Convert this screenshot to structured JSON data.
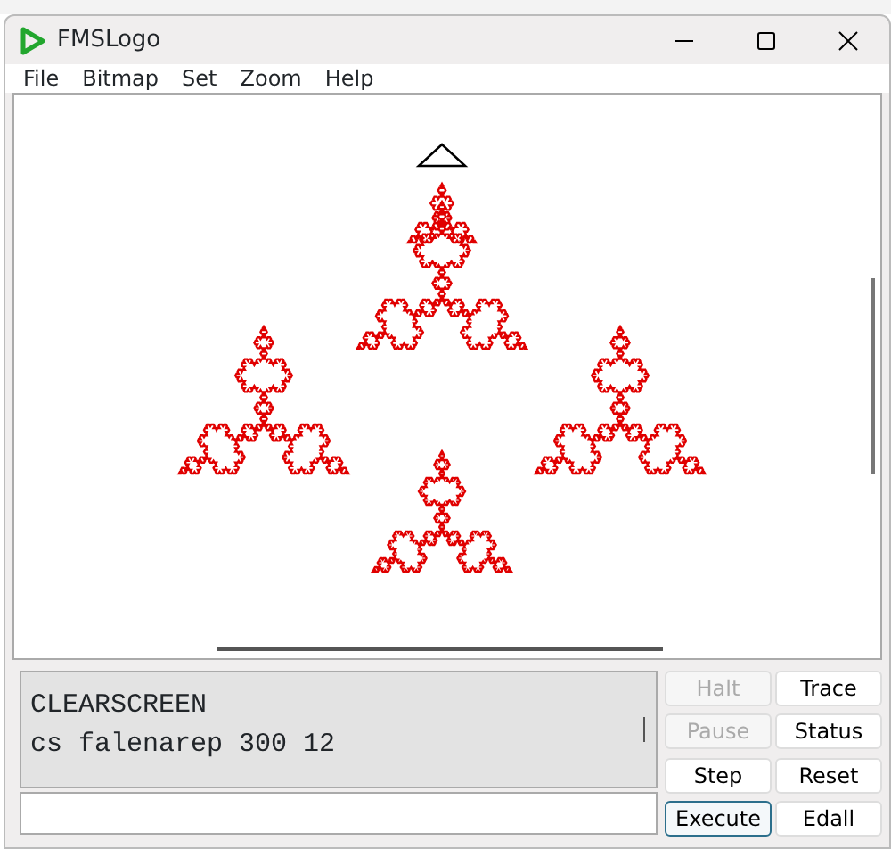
{
  "window": {
    "title": "FMSLogo"
  },
  "menu": [
    "File",
    "Bitmap",
    "Set",
    "Zoom",
    "Help"
  ],
  "history": [
    "CLEARSCREEN",
    "cs falenarep 300 12"
  ],
  "buttons": [
    {
      "label": "Halt",
      "disabled": true,
      "focused": false
    },
    {
      "label": "Trace",
      "disabled": false,
      "focused": false
    },
    {
      "label": "Pause",
      "disabled": true,
      "focused": false
    },
    {
      "label": "Status",
      "disabled": false,
      "focused": false
    },
    {
      "label": "Step",
      "disabled": false,
      "focused": false
    },
    {
      "label": "Reset",
      "disabled": false,
      "focused": false
    },
    {
      "label": "Execute",
      "disabled": false,
      "focused": true
    },
    {
      "label": "Edall",
      "disabled": false,
      "focused": false
    }
  ]
}
